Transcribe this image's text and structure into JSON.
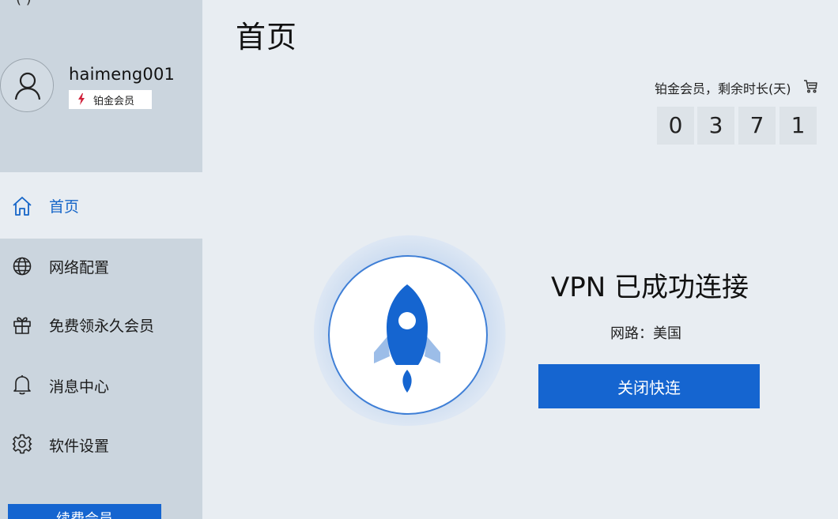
{
  "sidebar": {
    "top_cut_text": "(                    )",
    "profile": {
      "username": "haimeng001",
      "badge": "铂金会员"
    },
    "nav": [
      {
        "label": "首页",
        "icon": "home-icon",
        "active": true
      },
      {
        "label": "网络配置",
        "icon": "globe-icon"
      },
      {
        "label": "免费领永久会员",
        "icon": "gift-icon"
      },
      {
        "label": "消息中心",
        "icon": "bell-icon"
      },
      {
        "label": "软件设置",
        "icon": "gear-icon"
      }
    ],
    "renew_button": "续费会员"
  },
  "main": {
    "title": "首页",
    "membership_text": "铂金会员，剩余时长(天)",
    "days_digits": [
      "0",
      "3",
      "7",
      "1"
    ],
    "status_title": "VPN 已成功连接",
    "network_text": "网路：美国",
    "disconnect_button": "关闭快连"
  },
  "colors": {
    "accent": "#1565d0",
    "sidebar_bg": "#cbd5de",
    "main_bg": "#e8edf2",
    "badge_bolt": "#d0213a"
  }
}
